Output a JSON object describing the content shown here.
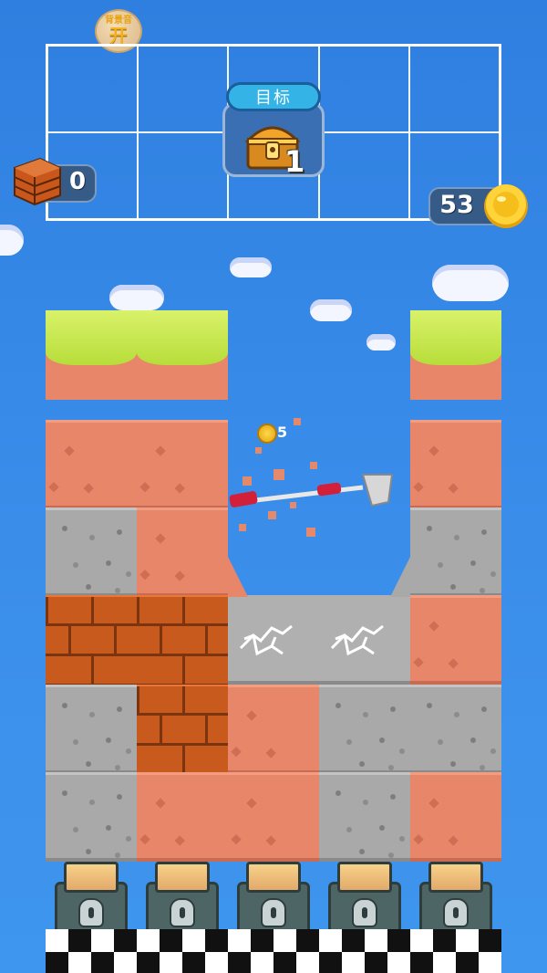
{
  "hud": {
    "music_button": {
      "line1": "背景音",
      "line2": "开"
    },
    "target": {
      "label": "目标",
      "item": "treasure-chest",
      "count": "1"
    },
    "bricks": {
      "count": "0"
    },
    "coins": {
      "count": "53"
    }
  },
  "effects": {
    "coin_reward": "5"
  },
  "board": {
    "columns": 5,
    "rows": [
      [
        "grass",
        "grass",
        "empty",
        "empty",
        "grass"
      ],
      [
        "dirt",
        "dirt",
        "empty",
        "empty",
        "dirt"
      ],
      [
        "stone",
        "dirt",
        "empty",
        "empty",
        "stone"
      ],
      [
        "brick",
        "brick",
        "cracked-stone",
        "cracked-stone",
        "dirt"
      ],
      [
        "stone",
        "brick",
        "dirt",
        "stone",
        "stone"
      ],
      [
        "stone",
        "dirt",
        "dirt",
        "stone",
        "dirt"
      ]
    ]
  },
  "colors": {
    "sky": "#3a8eea",
    "dirt": "#e8866a",
    "stone": "#a9a9a9",
    "brick": "#c95a1e",
    "grass": "#b7dd3a",
    "coin": "#ffd84a"
  }
}
